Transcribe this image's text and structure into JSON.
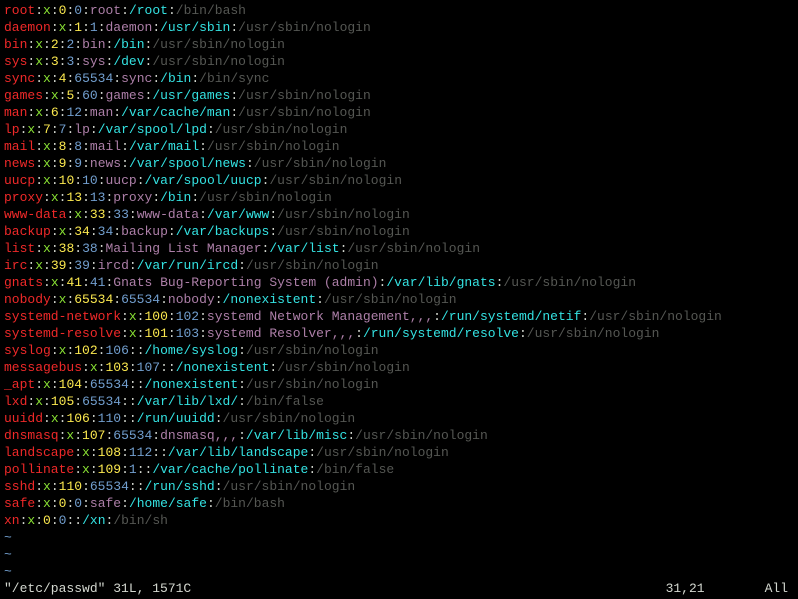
{
  "entries": [
    {
      "user": "root",
      "x": "x",
      "uid": "0",
      "gid": "0",
      "gecos": "root",
      "home": "/root",
      "shell": "/bin/bash"
    },
    {
      "user": "daemon",
      "x": "x",
      "uid": "1",
      "gid": "1",
      "gecos": "daemon",
      "home": "/usr/sbin",
      "shell": "/usr/sbin/nologin"
    },
    {
      "user": "bin",
      "x": "x",
      "uid": "2",
      "gid": "2",
      "gecos": "bin",
      "home": "/bin",
      "shell": "/usr/sbin/nologin"
    },
    {
      "user": "sys",
      "x": "x",
      "uid": "3",
      "gid": "3",
      "gecos": "sys",
      "home": "/dev",
      "shell": "/usr/sbin/nologin"
    },
    {
      "user": "sync",
      "x": "x",
      "uid": "4",
      "gid": "65534",
      "gecos": "sync",
      "home": "/bin",
      "shell": "/bin/sync"
    },
    {
      "user": "games",
      "x": "x",
      "uid": "5",
      "gid": "60",
      "gecos": "games",
      "home": "/usr/games",
      "shell": "/usr/sbin/nologin"
    },
    {
      "user": "man",
      "x": "x",
      "uid": "6",
      "gid": "12",
      "gecos": "man",
      "home": "/var/cache/man",
      "shell": "/usr/sbin/nologin"
    },
    {
      "user": "lp",
      "x": "x",
      "uid": "7",
      "gid": "7",
      "gecos": "lp",
      "home": "/var/spool/lpd",
      "shell": "/usr/sbin/nologin"
    },
    {
      "user": "mail",
      "x": "x",
      "uid": "8",
      "gid": "8",
      "gecos": "mail",
      "home": "/var/mail",
      "shell": "/usr/sbin/nologin"
    },
    {
      "user": "news",
      "x": "x",
      "uid": "9",
      "gid": "9",
      "gecos": "news",
      "home": "/var/spool/news",
      "shell": "/usr/sbin/nologin"
    },
    {
      "user": "uucp",
      "x": "x",
      "uid": "10",
      "gid": "10",
      "gecos": "uucp",
      "home": "/var/spool/uucp",
      "shell": "/usr/sbin/nologin"
    },
    {
      "user": "proxy",
      "x": "x",
      "uid": "13",
      "gid": "13",
      "gecos": "proxy",
      "home": "/bin",
      "shell": "/usr/sbin/nologin"
    },
    {
      "user": "www-data",
      "x": "x",
      "uid": "33",
      "gid": "33",
      "gecos": "www-data",
      "home": "/var/www",
      "shell": "/usr/sbin/nologin"
    },
    {
      "user": "backup",
      "x": "x",
      "uid": "34",
      "gid": "34",
      "gecos": "backup",
      "home": "/var/backups",
      "shell": "/usr/sbin/nologin"
    },
    {
      "user": "list",
      "x": "x",
      "uid": "38",
      "gid": "38",
      "gecos": "Mailing List Manager",
      "home": "/var/list",
      "shell": "/usr/sbin/nologin"
    },
    {
      "user": "irc",
      "x": "x",
      "uid": "39",
      "gid": "39",
      "gecos": "ircd",
      "home": "/var/run/ircd",
      "shell": "/usr/sbin/nologin"
    },
    {
      "user": "gnats",
      "x": "x",
      "uid": "41",
      "gid": "41",
      "gecos": "Gnats Bug-Reporting System (admin)",
      "home": "/var/lib/gnats",
      "shell": "/usr/sbin/nologin"
    },
    {
      "user": "nobody",
      "x": "x",
      "uid": "65534",
      "gid": "65534",
      "gecos": "nobody",
      "home": "/nonexistent",
      "shell": "/usr/sbin/nologin"
    },
    {
      "user": "systemd-network",
      "x": "x",
      "uid": "100",
      "gid": "102",
      "gecos": "systemd Network Management,,,",
      "home": "/run/systemd/netif",
      "shell": "/usr/sbin/nologin"
    },
    {
      "user": "systemd-resolve",
      "x": "x",
      "uid": "101",
      "gid": "103",
      "gecos": "systemd Resolver,,,",
      "home": "/run/systemd/resolve",
      "shell": "/usr/sbin/nologin"
    },
    {
      "user": "syslog",
      "x": "x",
      "uid": "102",
      "gid": "106",
      "gecos": "",
      "home": "/home/syslog",
      "shell": "/usr/sbin/nologin"
    },
    {
      "user": "messagebus",
      "x": "x",
      "uid": "103",
      "gid": "107",
      "gecos": "",
      "home": "/nonexistent",
      "shell": "/usr/sbin/nologin"
    },
    {
      "user": "_apt",
      "x": "x",
      "uid": "104",
      "gid": "65534",
      "gecos": "",
      "home": "/nonexistent",
      "shell": "/usr/sbin/nologin"
    },
    {
      "user": "lxd",
      "x": "x",
      "uid": "105",
      "gid": "65534",
      "gecos": "",
      "home": "/var/lib/lxd/",
      "shell": "/bin/false"
    },
    {
      "user": "uuidd",
      "x": "x",
      "uid": "106",
      "gid": "110",
      "gecos": "",
      "home": "/run/uuidd",
      "shell": "/usr/sbin/nologin"
    },
    {
      "user": "dnsmasq",
      "x": "x",
      "uid": "107",
      "gid": "65534",
      "gecos": "dnsmasq,,,",
      "home": "/var/lib/misc",
      "shell": "/usr/sbin/nologin"
    },
    {
      "user": "landscape",
      "x": "x",
      "uid": "108",
      "gid": "112",
      "gecos": "",
      "home": "/var/lib/landscape",
      "shell": "/usr/sbin/nologin"
    },
    {
      "user": "pollinate",
      "x": "x",
      "uid": "109",
      "gid": "1",
      "gecos": "",
      "home": "/var/cache/pollinate",
      "shell": "/bin/false"
    },
    {
      "user": "sshd",
      "x": "x",
      "uid": "110",
      "gid": "65534",
      "gecos": "",
      "home": "/run/sshd",
      "shell": "/usr/sbin/nologin"
    },
    {
      "user": "safe",
      "x": "x",
      "uid": "0",
      "gid": "0",
      "gecos": "safe",
      "home": "/home/safe",
      "shell": "/bin/bash"
    },
    {
      "user": "xn",
      "x": "x",
      "uid": "0",
      "gid": "0",
      "gecos": "",
      "home": "/xn",
      "shell": "/bin/sh"
    }
  ],
  "tilde": "~",
  "status": {
    "filename": "\"/etc/passwd\" 31L, 1571C",
    "position": "31,21",
    "scroll": "All"
  }
}
